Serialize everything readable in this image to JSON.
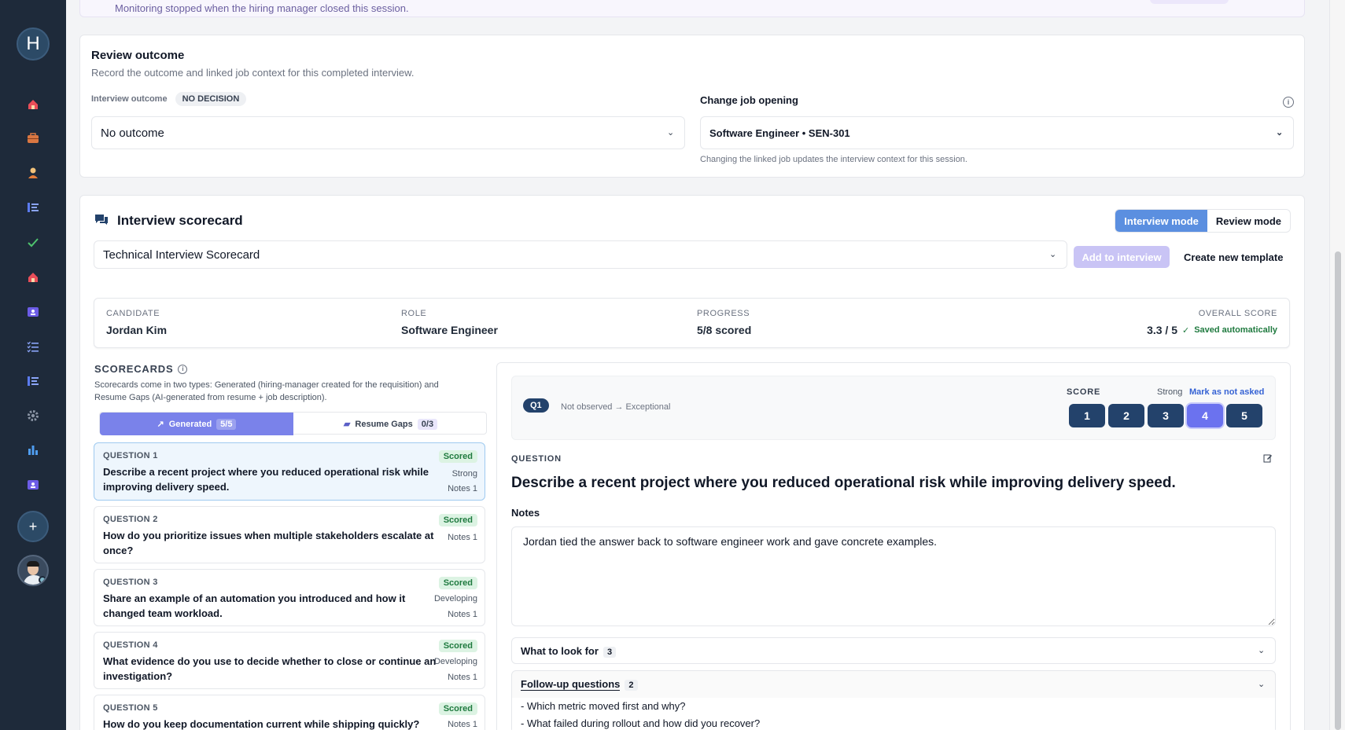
{
  "banner": {
    "text": "Monitoring stopped when the hiring manager closed this session."
  },
  "sidebar": {
    "logo": "H",
    "plus": "+"
  },
  "review": {
    "title": "Review outcome",
    "subtitle": "Record the outcome and linked job context for this completed interview.",
    "outcome_label": "Interview outcome",
    "outcome_badge": "NO DECISION",
    "outcome_value": "No outcome",
    "job_label": "Change job opening",
    "job_value": "Software Engineer • SEN-301",
    "job_help": "Changing the linked job updates the interview context for this session."
  },
  "scorecard": {
    "title": "Interview scorecard",
    "mode_interview": "Interview mode",
    "mode_review": "Review mode",
    "template_value": "Technical Interview Scorecard",
    "add_button": "Add to interview",
    "create_button": "Create new template",
    "summary": {
      "candidate_label": "CANDIDATE",
      "candidate": "Jordan Kim",
      "role_label": "ROLE",
      "role": "Software Engineer",
      "progress_label": "PROGRESS",
      "progress": "5/8 scored",
      "overall_label": "OVERALL SCORE",
      "overall": "3.3 / 5",
      "saved": "Saved automatically"
    },
    "scorecards_title": "SCORECARDS",
    "scorecards_desc": "Scorecards come in two types: Generated (hiring-manager created for the requisition) and Resume Gaps (AI-generated from resume + job description).",
    "tab_generated": "Generated",
    "tab_generated_count": "5/5",
    "tab_resume": "Resume Gaps",
    "tab_resume_count": "0/3",
    "questions": [
      {
        "num": "QUESTION 1",
        "text": "Describe a recent project where you reduced operational risk while improving delivery speed.",
        "status": "Scored",
        "rating": "Strong",
        "notes": "Notes 1"
      },
      {
        "num": "QUESTION 2",
        "text": "How do you prioritize issues when multiple stakeholders escalate at once?",
        "status": "Scored",
        "rating": "",
        "notes": "Notes 1"
      },
      {
        "num": "QUESTION 3",
        "text": "Share an example of an automation you introduced and how it changed team workload.",
        "status": "Scored",
        "rating": "Developing",
        "notes": "Notes 1"
      },
      {
        "num": "QUESTION 4",
        "text": "What evidence do you use to decide whether to close or continue an investigation?",
        "status": "Scored",
        "rating": "Developing",
        "notes": "Notes 1"
      },
      {
        "num": "QUESTION 5",
        "text": "How do you keep documentation current while shipping quickly?",
        "status": "Scored",
        "rating": "",
        "notes": "Notes 1"
      }
    ],
    "detail": {
      "q_badge": "Q1",
      "scale": "Not observed → Exceptional",
      "score_label": "SCORE",
      "score_rating": "Strong",
      "mark_not_asked": "Mark as not asked",
      "scores": [
        "1",
        "2",
        "3",
        "4",
        "5"
      ],
      "selected_score": 4,
      "question_label": "QUESTION",
      "question_text": "Describe a recent project where you reduced operational risk while improving delivery speed.",
      "notes_label": "Notes",
      "notes_value": "Jordan tied the answer back to software engineer work and gave concrete examples.",
      "look_for_label": "What to look for",
      "look_for_count": "3",
      "followup_label": "Follow-up questions",
      "followup_count": "2",
      "followups": [
        "- Which metric moved first and why?",
        "- What failed during rollout and how did you recover?"
      ]
    }
  },
  "colors": {
    "accent": "#6b72ef",
    "navy": "#23426b",
    "sidebar": "#1e2a3a",
    "scored_bg": "#dcf3e3"
  }
}
